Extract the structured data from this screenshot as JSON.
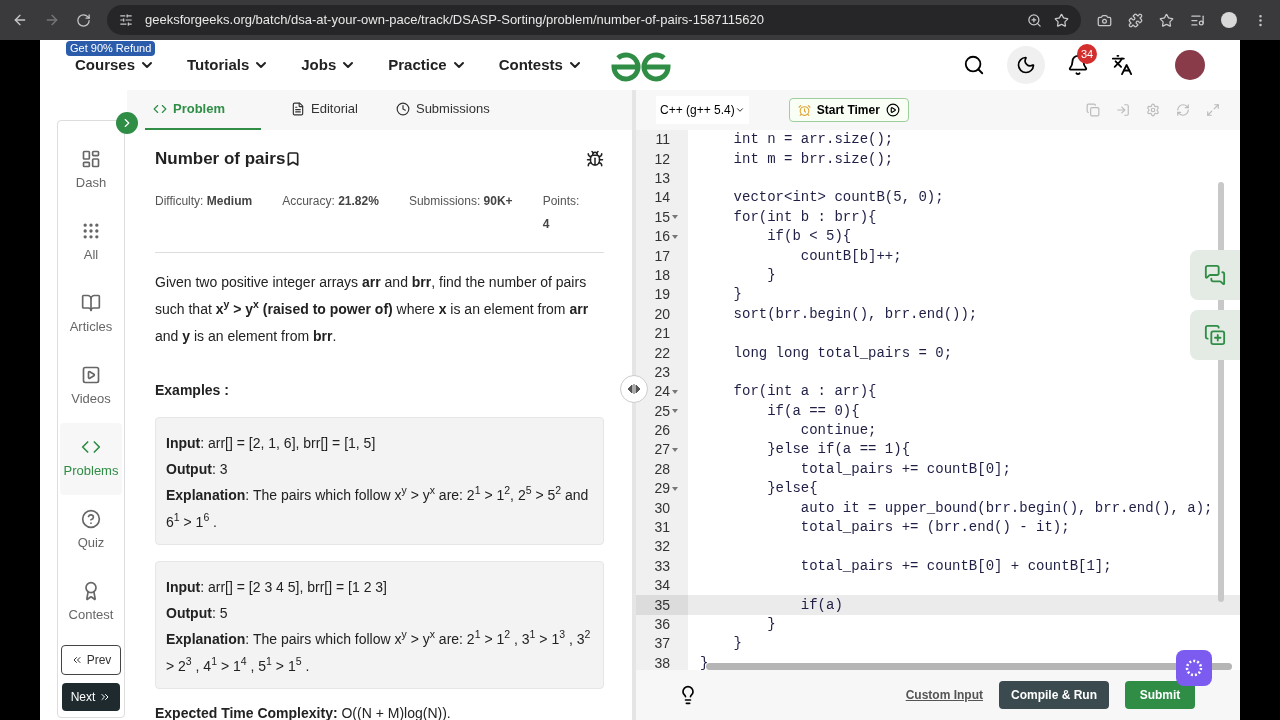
{
  "browser": {
    "url": "geeksforgeeks.org/batch/dsa-at-your-own-pace/track/DSASP-Sorting/problem/number-of-pairs-1587115620"
  },
  "nav": {
    "refund_badge": "Get 90% Refund",
    "items": [
      "Courses",
      "Tutorials",
      "Jobs",
      "Practice",
      "Contests"
    ],
    "notification_count": "34"
  },
  "tabs": [
    {
      "label": "Problem",
      "selected": true
    },
    {
      "label": "Editorial",
      "selected": false
    },
    {
      "label": "Submissions",
      "selected": false
    }
  ],
  "rail": {
    "items": [
      {
        "label": "Dash",
        "selected": false
      },
      {
        "label": "All",
        "selected": false
      },
      {
        "label": "Articles",
        "selected": false
      },
      {
        "label": "Videos",
        "selected": false
      },
      {
        "label": "Problems",
        "selected": true
      },
      {
        "label": "Quiz",
        "selected": false
      },
      {
        "label": "Contest",
        "selected": false
      }
    ],
    "prev": "Prev",
    "next": "Next"
  },
  "problem": {
    "title": "Number of pairs",
    "meta": [
      {
        "label": "Difficulty:",
        "value": "Medium"
      },
      {
        "label": "Accuracy:",
        "value": "21.82%"
      },
      {
        "label": "Submissions:",
        "value": "90K+"
      },
      {
        "label": "Points:",
        "value": "4"
      }
    ],
    "description": "Given two positive integer arrays **arr** and **brr**, find the number of pairs such that **x$^{y}$ > y$^{x}$ (raised to power of)** where **x** is an element from **arr** and **y** is an element from **brr**.",
    "examples_heading": "Examples :",
    "examples": [
      {
        "input_label": "Input",
        "input": ": arr[] = [2, 1, 6], brr[] = [1, 5]",
        "output_label": "Output",
        "output": ": 3",
        "explanation_label": "Explanation",
        "explanation": ": The pairs which follow x$^{y}$ > y$^{x}$ are: 2$^{1}$ > 1$^{2}$,  2$^{5}$ > 5$^{2}$ and 6$^{1}$ > 1$^{6}$ ."
      },
      {
        "input_label": "Input",
        "input": ": arr[] = [2 3 4 5], brr[] = [1 2 3]",
        "output_label": "Output",
        "output": ": 5",
        "explanation_label": "Explanation",
        "explanation": ": The pairs which follow x$^{y}$ > y$^{x}$ are: 2$^{1}$ > 1$^{2}$ , 3$^{1}$ > 1$^{3}$ , 3$^{2}$ > 2$^{3}$ , 4$^{1}$ > 1$^{4}$ , 5$^{1}$ > 1$^{5}$ ."
      }
    ],
    "complexity_label": "Expected Time Complexity:",
    "complexity": "O((N + M)log(N))."
  },
  "editor": {
    "language": "C++ (g++ 5.4)",
    "timer": "Start Timer",
    "lines": [
      {
        "number": "11",
        "code": "    int n = arr.size();",
        "foldable": false,
        "current": false
      },
      {
        "number": "12",
        "code": "    int m = brr.size();",
        "foldable": false,
        "current": false
      },
      {
        "number": "13",
        "foldable": false,
        "current": false
      },
      {
        "number": "14",
        "code": "    vector<int> countB(5, 0);",
        "foldable": false,
        "current": false
      },
      {
        "number": "15",
        "code": "    for(int b : brr){",
        "foldable": true,
        "current": false
      },
      {
        "number": "16",
        "code": "        if(b < 5){",
        "foldable": true,
        "current": false
      },
      {
        "number": "17",
        "code": "            countB[b]++;",
        "foldable": false,
        "current": false
      },
      {
        "number": "18",
        "code": "        }",
        "foldable": false,
        "current": false
      },
      {
        "number": "19",
        "code": "    }",
        "foldable": false,
        "current": false
      },
      {
        "number": "20",
        "code": "    sort(brr.begin(), brr.end());",
        "foldable": false,
        "current": false
      },
      {
        "number": "21",
        "foldable": false,
        "current": false
      },
      {
        "number": "22",
        "code": "    long long total_pairs = 0;",
        "foldable": false,
        "current": false
      },
      {
        "number": "23",
        "foldable": false,
        "current": false
      },
      {
        "number": "24",
        "code": "    for(int a : arr){",
        "foldable": true,
        "current": false
      },
      {
        "number": "25",
        "code": "        if(a == 0){",
        "foldable": true,
        "current": false
      },
      {
        "number": "26",
        "code": "            continue;",
        "foldable": false,
        "current": false
      },
      {
        "number": "27",
        "code": "        }else if(a == 1){",
        "foldable": true,
        "current": false
      },
      {
        "number": "28",
        "code": "            total_pairs += countB[0];",
        "foldable": false,
        "current": false
      },
      {
        "number": "29",
        "code": "        }else{",
        "foldable": true,
        "current": false
      },
      {
        "number": "30",
        "code": "            auto it = upper_bound(brr.begin(), brr.end(), a);",
        "foldable": false,
        "current": false
      },
      {
        "number": "31",
        "code": "            total_pairs += (brr.end() - it);",
        "foldable": false,
        "current": false
      },
      {
        "number": "32",
        "foldable": false,
        "current": false
      },
      {
        "number": "33",
        "code": "            total_pairs += countB[0] + countB[1];",
        "foldable": false,
        "current": false
      },
      {
        "number": "34",
        "foldable": false,
        "current": false
      },
      {
        "number": "35",
        "code": "            if(a)",
        "foldable": false,
        "current": true
      },
      {
        "number": "36",
        "code": "        }",
        "foldable": false,
        "current": false
      },
      {
        "number": "37",
        "code": "    }",
        "foldable": false,
        "current": false
      },
      {
        "number": "38",
        "code": "}",
        "foldable": false,
        "current": false
      }
    ],
    "custom_input": "Custom Input",
    "compile": "Compile & Run",
    "submit": "Submit"
  }
}
